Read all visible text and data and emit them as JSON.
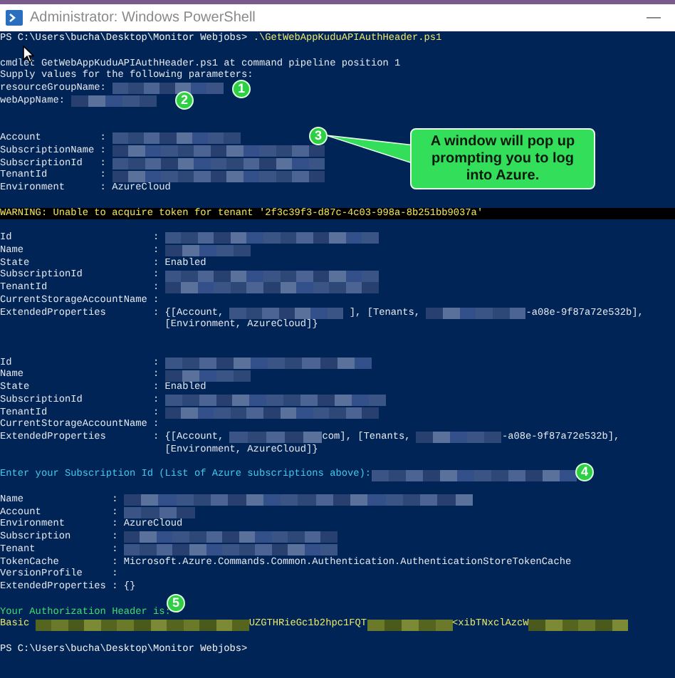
{
  "window": {
    "title": "Administrator: Windows PowerShell",
    "controls": [
      "—"
    ]
  },
  "console": [
    {
      "kind": "prompt",
      "segments": [
        {
          "kind": "text",
          "text": "PS C:\\Users\\bucha\\Desktop\\Monitor Webjobs> "
        },
        {
          "kind": "command",
          "text": ".\\GetWebAppKuduAPIAuthHeader.ps1"
        }
      ]
    },
    {
      "kind": "blank"
    },
    {
      "kind": "output",
      "segments": [
        {
          "kind": "text",
          "text": "cmdlet GetWebAppKuduAPIAuthHeader.ps1 at command pipeline position 1"
        }
      ]
    },
    {
      "kind": "output",
      "segments": [
        {
          "kind": "text",
          "text": "Supply values for the following parameters:"
        }
      ]
    },
    {
      "kind": "output",
      "segments": [
        {
          "kind": "text",
          "text": "resourceGroupName: "
        },
        {
          "kind": "redacted"
        }
      ]
    },
    {
      "kind": "output",
      "segments": [
        {
          "kind": "text",
          "text": "webAppName: "
        },
        {
          "kind": "redacted"
        }
      ]
    },
    {
      "kind": "blank"
    },
    {
      "kind": "blank"
    },
    {
      "kind": "output",
      "segments": [
        {
          "kind": "text",
          "text": "Account          : "
        },
        {
          "kind": "redacted"
        }
      ]
    },
    {
      "kind": "output",
      "segments": [
        {
          "kind": "text",
          "text": "SubscriptionName : "
        },
        {
          "kind": "redacted"
        }
      ]
    },
    {
      "kind": "output",
      "segments": [
        {
          "kind": "text",
          "text": "SubscriptionId   : "
        },
        {
          "kind": "redacted"
        }
      ]
    },
    {
      "kind": "output",
      "segments": [
        {
          "kind": "text",
          "text": "TenantId         : "
        },
        {
          "kind": "redacted"
        }
      ]
    },
    {
      "kind": "output",
      "segments": [
        {
          "kind": "text",
          "text": "Environment      : AzureCloud"
        }
      ]
    },
    {
      "kind": "blank"
    },
    {
      "kind": "warning",
      "segments": [
        {
          "kind": "text",
          "text": "WARNING: Unable to acquire token for tenant '2f3c39f3-d87c-4c03-998a-8b251bb9037a'"
        }
      ]
    },
    {
      "kind": "blank"
    },
    {
      "kind": "output",
      "segments": [
        {
          "kind": "text",
          "text": "Id                        : "
        },
        {
          "kind": "redacted"
        }
      ]
    },
    {
      "kind": "output",
      "segments": [
        {
          "kind": "text",
          "text": "Name                      : "
        },
        {
          "kind": "redacted"
        }
      ]
    },
    {
      "kind": "output",
      "segments": [
        {
          "kind": "text",
          "text": "State                     : Enabled"
        }
      ]
    },
    {
      "kind": "output",
      "segments": [
        {
          "kind": "text",
          "text": "SubscriptionId            : "
        },
        {
          "kind": "redacted"
        }
      ]
    },
    {
      "kind": "output",
      "segments": [
        {
          "kind": "text",
          "text": "TenantId                  : "
        },
        {
          "kind": "redacted"
        }
      ]
    },
    {
      "kind": "output",
      "segments": [
        {
          "kind": "text",
          "text": "CurrentStorageAccountName :"
        }
      ]
    },
    {
      "kind": "output",
      "segments": [
        {
          "kind": "text",
          "text": "ExtendedProperties        : {[Account, "
        },
        {
          "kind": "redacted"
        },
        {
          "kind": "text",
          "text": " ], [Tenants, "
        },
        {
          "kind": "redacted"
        },
        {
          "kind": "text",
          "text": "-a08e-9f87a72e532b],"
        }
      ]
    },
    {
      "kind": "output",
      "segments": [
        {
          "kind": "text",
          "text": "                            [Environment, AzureCloud]}"
        }
      ]
    },
    {
      "kind": "blank"
    },
    {
      "kind": "blank"
    },
    {
      "kind": "output",
      "segments": [
        {
          "kind": "text",
          "text": "Id                        : "
        },
        {
          "kind": "redacted"
        }
      ]
    },
    {
      "kind": "output",
      "segments": [
        {
          "kind": "text",
          "text": "Name                      : "
        },
        {
          "kind": "redacted"
        }
      ]
    },
    {
      "kind": "output",
      "segments": [
        {
          "kind": "text",
          "text": "State                     : Enabled"
        }
      ]
    },
    {
      "kind": "output",
      "segments": [
        {
          "kind": "text",
          "text": "SubscriptionId            : "
        },
        {
          "kind": "redacted"
        }
      ]
    },
    {
      "kind": "output",
      "segments": [
        {
          "kind": "text",
          "text": "TenantId                  : "
        },
        {
          "kind": "redacted"
        }
      ]
    },
    {
      "kind": "output",
      "segments": [
        {
          "kind": "text",
          "text": "CurrentStorageAccountName :"
        }
      ]
    },
    {
      "kind": "output",
      "segments": [
        {
          "kind": "text",
          "text": "ExtendedProperties        : {[Account, "
        },
        {
          "kind": "redacted"
        },
        {
          "kind": "text",
          "text": "com], [Tenants, "
        },
        {
          "kind": "redacted"
        },
        {
          "kind": "text",
          "text": "-a08e-9f87a72e532b],"
        }
      ]
    },
    {
      "kind": "output",
      "segments": [
        {
          "kind": "text",
          "text": "                            [Environment, AzureCloud]}"
        }
      ]
    },
    {
      "kind": "blank"
    },
    {
      "kind": "input",
      "segments": [
        {
          "kind": "text",
          "text": "Enter your Subscription Id (List of Azure subscriptions above):"
        },
        {
          "kind": "redacted"
        }
      ]
    },
    {
      "kind": "blank"
    },
    {
      "kind": "output",
      "segments": [
        {
          "kind": "text",
          "text": "Name               : "
        },
        {
          "kind": "redacted"
        }
      ]
    },
    {
      "kind": "output",
      "segments": [
        {
          "kind": "text",
          "text": "Account            : "
        },
        {
          "kind": "redacted"
        }
      ]
    },
    {
      "kind": "output",
      "segments": [
        {
          "kind": "text",
          "text": "Environment        : AzureCloud"
        }
      ]
    },
    {
      "kind": "output",
      "segments": [
        {
          "kind": "text",
          "text": "Subscription       : "
        },
        {
          "kind": "redacted"
        }
      ]
    },
    {
      "kind": "output",
      "segments": [
        {
          "kind": "text",
          "text": "Tenant             : "
        },
        {
          "kind": "redacted"
        }
      ]
    },
    {
      "kind": "output",
      "segments": [
        {
          "kind": "text",
          "text": "TokenCache         : Microsoft.Azure.Commands.Common.Authentication.AuthenticationStoreTokenCache"
        }
      ]
    },
    {
      "kind": "output",
      "segments": [
        {
          "kind": "text",
          "text": "VersionProfile     :"
        }
      ]
    },
    {
      "kind": "output",
      "segments": [
        {
          "kind": "text",
          "text": "ExtendedProperties : {}"
        }
      ]
    },
    {
      "kind": "blank"
    },
    {
      "kind": "success",
      "segments": [
        {
          "kind": "text",
          "text": "Your Authorization Header is:"
        }
      ]
    },
    {
      "kind": "auth",
      "segments": [
        {
          "kind": "text",
          "text": "Basic "
        },
        {
          "kind": "redacted"
        },
        {
          "kind": "text",
          "text": "UZGTHRieGc1b2hpc1FQT"
        },
        {
          "kind": "redacted"
        },
        {
          "kind": "text",
          "text": "<xibTNxclAzcW"
        },
        {
          "kind": "redacted"
        }
      ]
    },
    {
      "kind": "blank"
    },
    {
      "kind": "prompt",
      "segments": [
        {
          "kind": "text",
          "text": "PS C:\\Users\\bucha\\Desktop\\Monitor Webjobs>"
        }
      ]
    }
  ],
  "markers": [
    "1",
    "2",
    "3",
    "4",
    "5"
  ],
  "callout": {
    "text": "A window will pop up prompting you to log into Azure."
  }
}
